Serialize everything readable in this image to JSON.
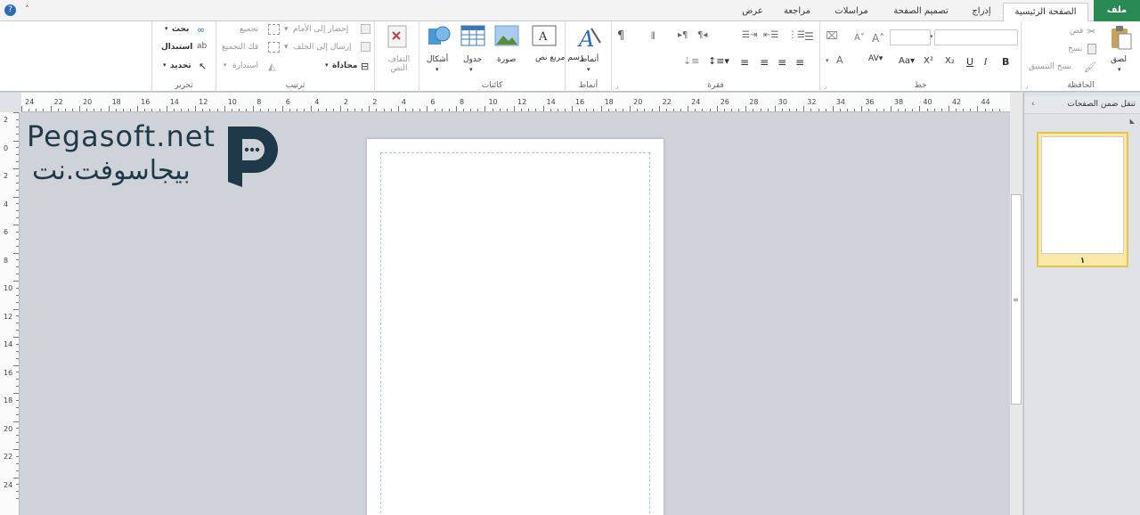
{
  "tabs": {
    "file": "ملف",
    "home": "الصفحة الرئيسية",
    "insert": "إدراج",
    "page_design": "تصميم الصفحة",
    "mailings": "مراسلات",
    "review": "مراجعة",
    "view": "عرض"
  },
  "groups": {
    "clipboard": "الحافظة",
    "font": "خط",
    "paragraph": "فقرة",
    "styles": "أنماط",
    "objects": "كائنات",
    "text": "",
    "arrange": "ترتيب",
    "editing": "تحرير"
  },
  "clipboard": {
    "paste": "لصق",
    "cut": "قص",
    "copy": "نسخ",
    "format_painter": "نسخ التنسيق"
  },
  "styles_btn": "أنماط",
  "objects": {
    "textbox": "رسم مربع نص",
    "picture": "صورة",
    "table": "جدول",
    "shapes": "أشكال"
  },
  "text_wrap": "التفاف النص",
  "arrange": {
    "bring_forward": "إحضار إلى الأمام",
    "send_backward": "إرسال إلى الخلف",
    "align": "محاذاة",
    "group": "تجميع",
    "ungroup": "فك التجميع",
    "rotate": "استدارة"
  },
  "editing": {
    "find": "بحث",
    "replace": "استبدال",
    "select": "تحديد"
  },
  "ruler_h": [
    "24",
    "22",
    "20",
    "18",
    "16",
    "14",
    "12",
    "10",
    "8",
    "6",
    "4",
    "2",
    "2",
    "4",
    "6",
    "8",
    "10",
    "12",
    "14",
    "16",
    "18",
    "20",
    "22",
    "24",
    "26",
    "28",
    "30",
    "32",
    "34",
    "36",
    "38",
    "40",
    "42",
    "44"
  ],
  "ruler_v": [
    "2",
    "0",
    "2",
    "4",
    "6",
    "8",
    "10",
    "12",
    "14",
    "16",
    "18",
    "20",
    "22",
    "24"
  ],
  "nav_pane": {
    "title": "تنقل ضمن الصفحات",
    "page_number": "١"
  },
  "watermark": {
    "latin": "Pegasoft.net",
    "arabic": "بيجاسوفت.نت"
  },
  "colors": {
    "file_tab": "#2a8a55",
    "logo": "#1e3a4a",
    "thumb_border": "#e6c44b"
  }
}
